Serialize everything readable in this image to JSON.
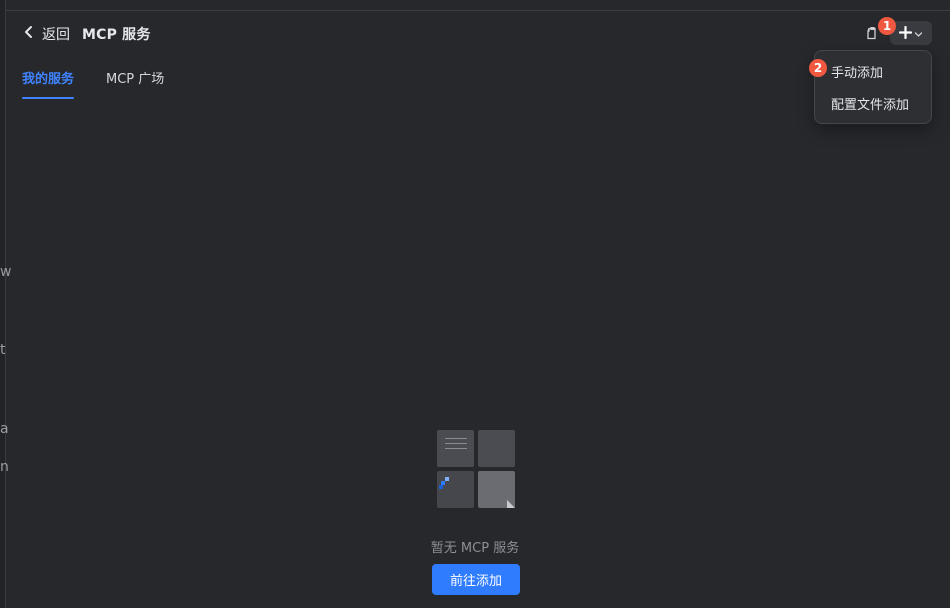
{
  "left_edge": {
    "chars": [
      "w",
      "t",
      "a",
      "n"
    ]
  },
  "header": {
    "back_label": "返回",
    "title": "MCP 服务"
  },
  "tabs": [
    {
      "label": "我的服务",
      "active": true
    },
    {
      "label": "MCP 广场",
      "active": false
    }
  ],
  "toolbar": {
    "badge1": "1",
    "badge2": "2"
  },
  "menu": {
    "items": [
      "手动添加",
      "配置文件添加"
    ]
  },
  "empty_state": {
    "message": "暂无 MCP 服务",
    "cta_label": "前往添加"
  },
  "colors": {
    "accent": "#2f7cff",
    "badge": "#f0583f",
    "background": "#27282c"
  }
}
